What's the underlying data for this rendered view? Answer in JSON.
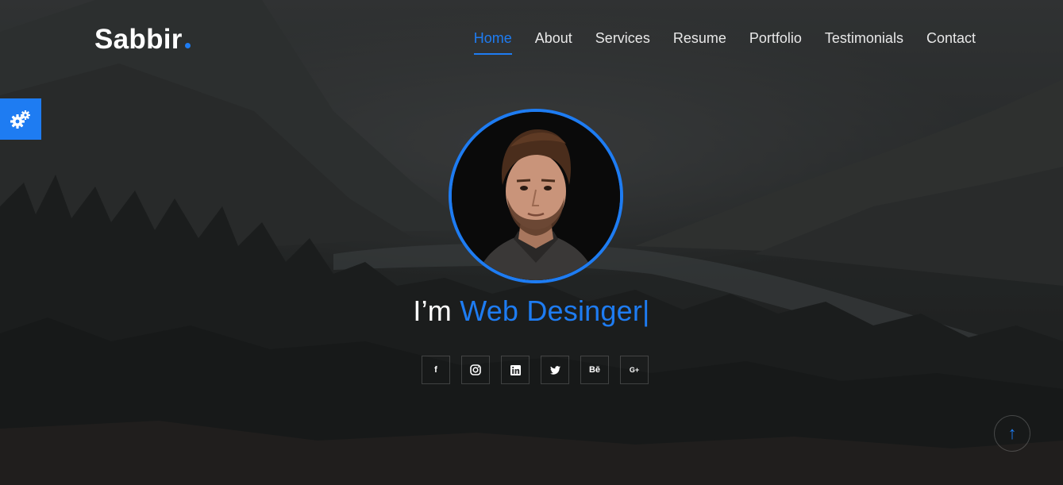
{
  "brand": {
    "name": "Sabbir",
    "accent": "#1e7cf2"
  },
  "nav": {
    "items": [
      {
        "label": "Home",
        "active": true
      },
      {
        "label": "About"
      },
      {
        "label": "Services"
      },
      {
        "label": "Resume"
      },
      {
        "label": "Portfolio"
      },
      {
        "label": "Testimonials"
      },
      {
        "label": "Contact"
      }
    ]
  },
  "hero": {
    "prefix": "I’m",
    "role": "Web Desinger",
    "cursor": "|"
  },
  "social": {
    "items": [
      {
        "icon": "facebook-icon",
        "glyph": "f"
      },
      {
        "icon": "instagram-icon",
        "glyph": ""
      },
      {
        "icon": "linkedin-icon",
        "glyph": "in"
      },
      {
        "icon": "twitter-icon",
        "glyph": ""
      },
      {
        "icon": "behance-icon",
        "glyph": "Bē"
      },
      {
        "icon": "google-plus-icon",
        "glyph": "G+"
      }
    ]
  },
  "widgets": {
    "settings_icon": "gear-icon",
    "scroll_top_icon": "arrow-up-icon",
    "scroll_top_glyph": "↑"
  }
}
